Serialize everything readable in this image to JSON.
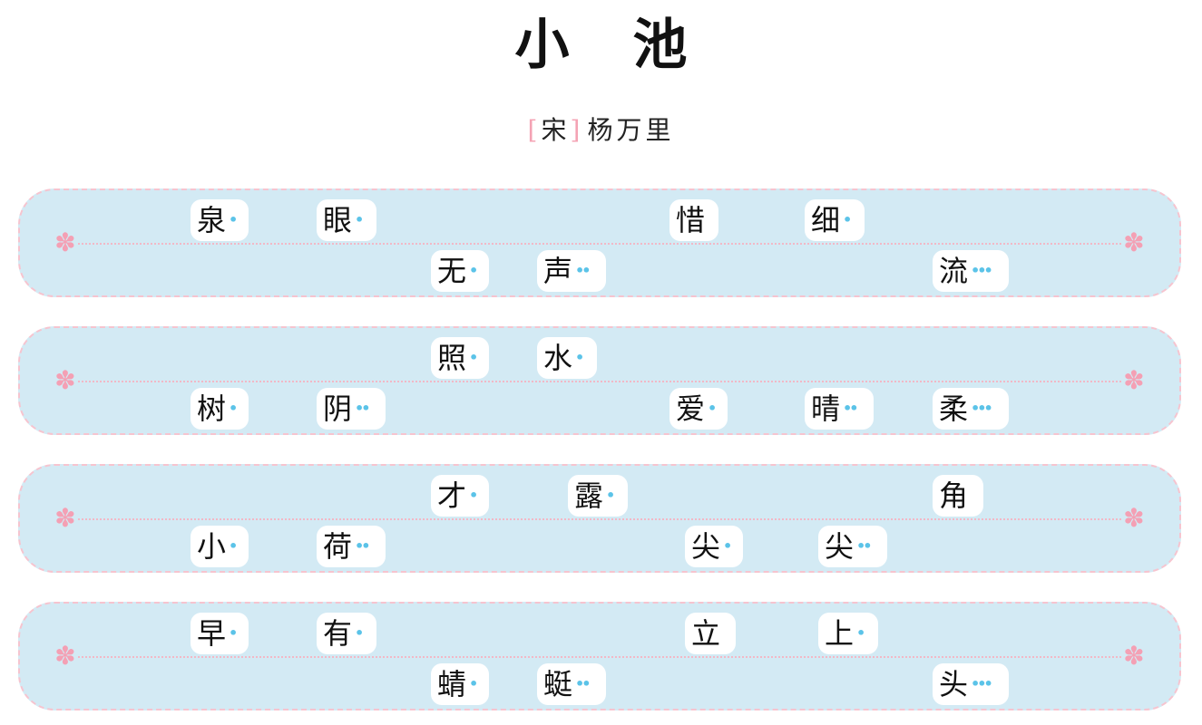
{
  "title": "小池",
  "dynasty": "宋",
  "poet": "杨万里",
  "bracket_open": "[",
  "bracket_close": "]",
  "dot_color": "#5bc3e8",
  "flower_icon": "✽",
  "lines": [
    [
      {
        "char": "泉",
        "dots": "•"
      },
      {
        "char": "眼",
        "dots": "•"
      },
      {
        "char": "无",
        "dots": "•"
      },
      {
        "char": "声",
        "dots": "••"
      },
      {
        "char": "惜",
        "dots": ""
      },
      {
        "char": "细",
        "dots": "•"
      },
      {
        "char": "流",
        "dots": "•••"
      }
    ],
    [
      {
        "char": "树",
        "dots": "•"
      },
      {
        "char": "阴",
        "dots": "••"
      },
      {
        "char": "照",
        "dots": "•"
      },
      {
        "char": "水",
        "dots": "•"
      },
      {
        "char": "爱",
        "dots": "•"
      },
      {
        "char": "晴",
        "dots": "••"
      },
      {
        "char": "柔",
        "dots": "•••"
      }
    ],
    [
      {
        "char": "小",
        "dots": "•"
      },
      {
        "char": "荷",
        "dots": "••"
      },
      {
        "char": "才",
        "dots": "•"
      },
      {
        "char": "露",
        "dots": "•"
      },
      {
        "char": "尖",
        "dots": "•"
      },
      {
        "char": "尖",
        "dots": "••"
      },
      {
        "char": "角",
        "dots": ""
      }
    ],
    [
      {
        "char": "早",
        "dots": "•"
      },
      {
        "char": "有",
        "dots": "•"
      },
      {
        "char": "蜻",
        "dots": "•"
      },
      {
        "char": "蜓",
        "dots": "••"
      },
      {
        "char": "立",
        "dots": ""
      },
      {
        "char": "上",
        "dots": "•"
      },
      {
        "char": "头",
        "dots": "•••"
      }
    ]
  ]
}
